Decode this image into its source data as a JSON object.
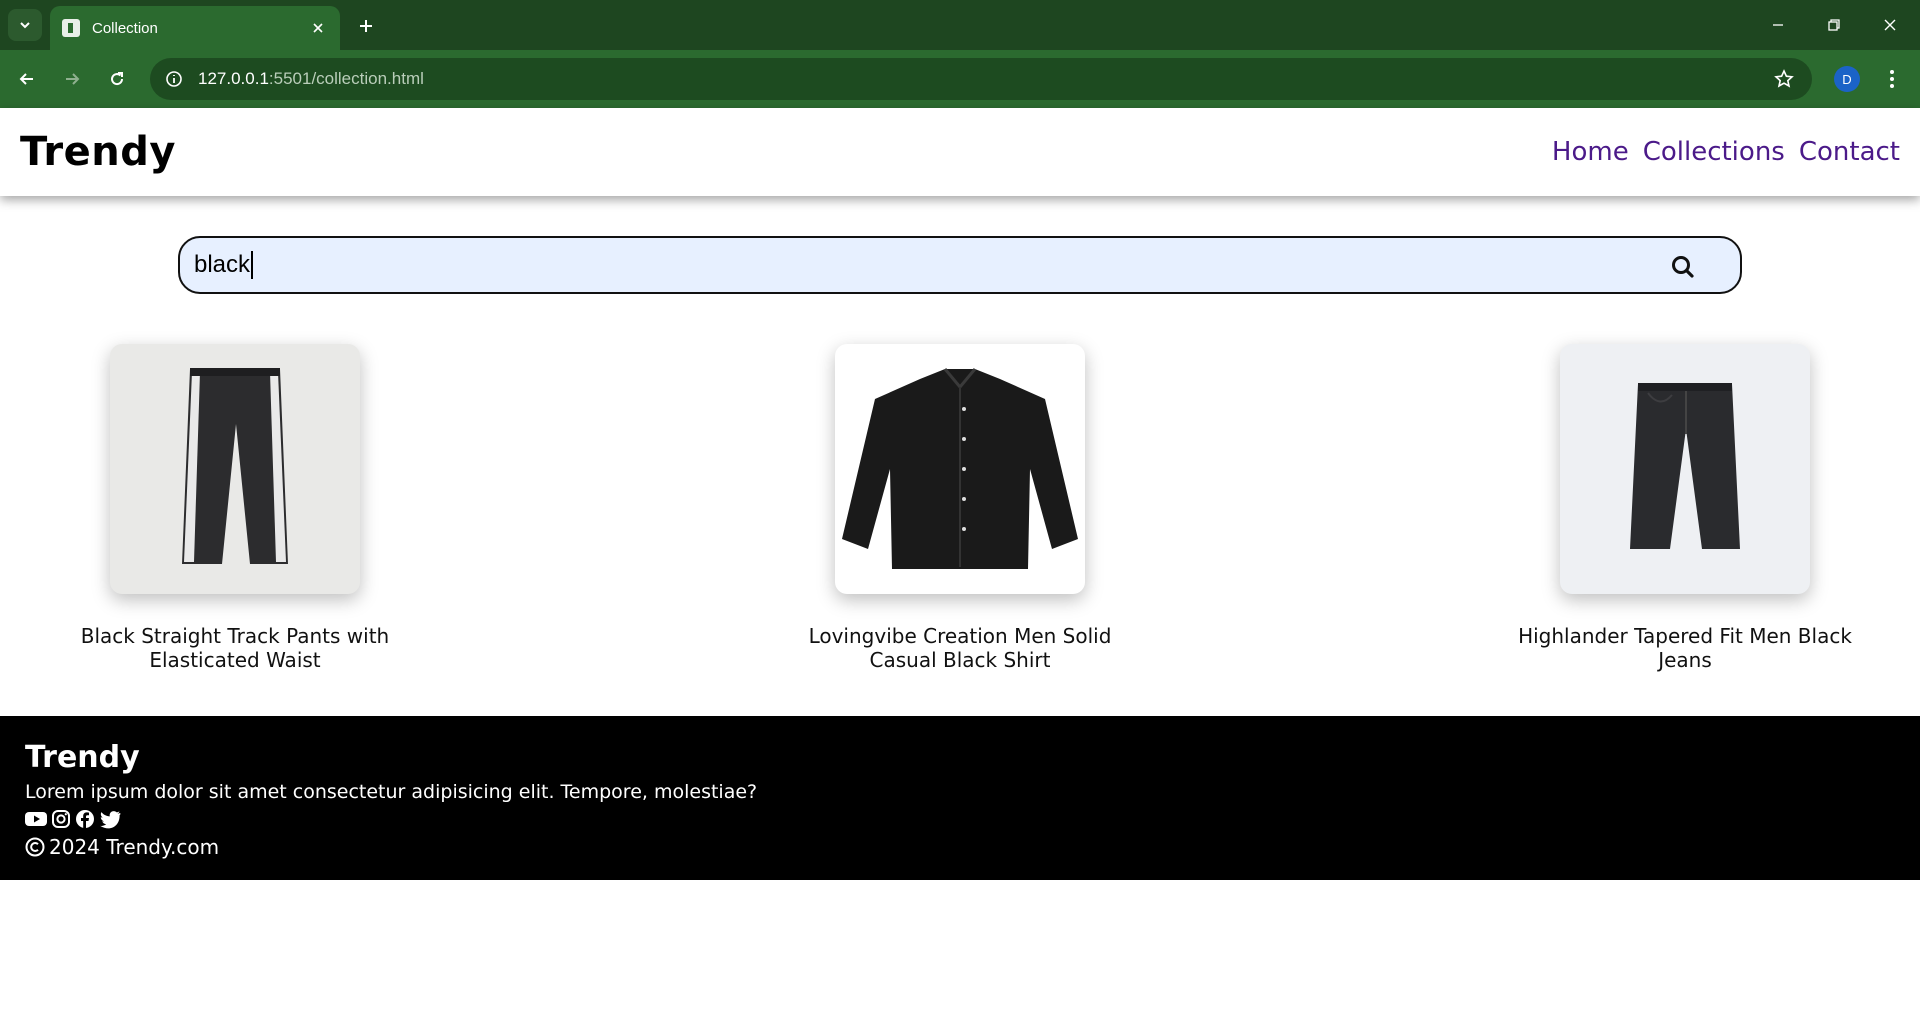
{
  "browser": {
    "tab_title": "Collection",
    "url_host": "127.0.0.1",
    "url_rest": ":5501/collection.html",
    "profile_initial": "D"
  },
  "header": {
    "brand": "Trendy",
    "nav": [
      "Home",
      "Collections",
      "Contact"
    ]
  },
  "search": {
    "value": "black"
  },
  "products": [
    {
      "name": "Black Straight Track Pants with Elasticated Waist",
      "image": "track-pants-image"
    },
    {
      "name": "Lovingvibe Creation Men Solid Casual Black Shirt",
      "image": "black-shirt-image"
    },
    {
      "name": "Highlander Tapered Fit Men Black Jeans",
      "image": "black-jeans-image"
    }
  ],
  "footer": {
    "brand": "Trendy",
    "description": "Lorem ipsum dolor sit amet consectetur adipisicing elit. Tempore, molestiae?",
    "social_icons": [
      "youtube-icon",
      "instagram-icon",
      "facebook-icon",
      "twitter-icon"
    ],
    "copyright": "2024 Trendy.com"
  },
  "colors": {
    "chrome_dark": "#1e4620",
    "chrome_toolbar": "#2b6a2f",
    "nav_link": "#4b1a89",
    "search_bg": "#e7f0ff",
    "footer_bg": "#000000"
  }
}
